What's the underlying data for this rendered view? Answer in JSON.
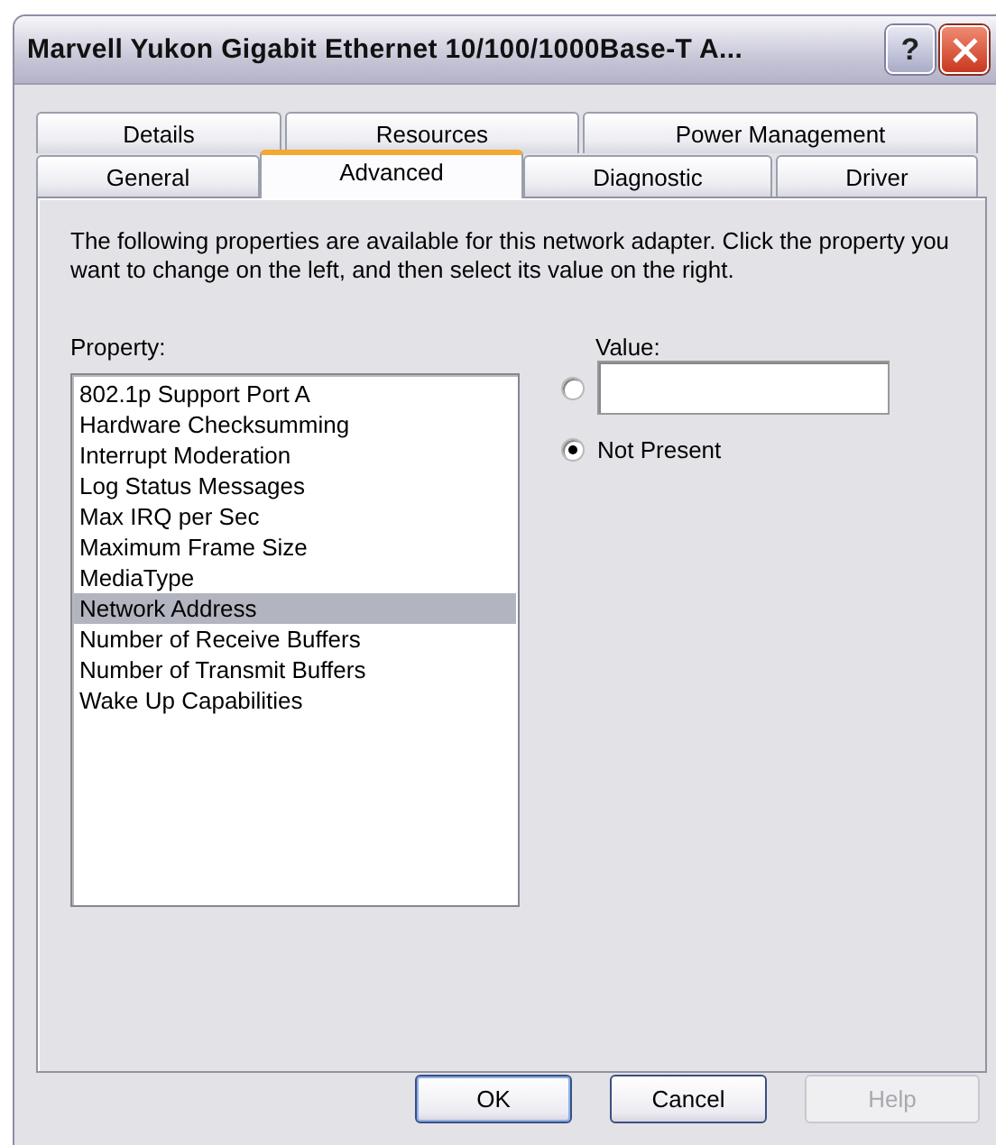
{
  "window": {
    "title": "Marvell Yukon Gigabit Ethernet 10/100/1000Base-T A...",
    "help_button": "?"
  },
  "tab_rows": [
    [
      {
        "label": "Details",
        "selected": false
      },
      {
        "label": "Resources",
        "selected": false
      },
      {
        "label": "Power Management",
        "selected": false
      }
    ],
    [
      {
        "label": "General",
        "selected": false
      },
      {
        "label": "Advanced",
        "selected": true
      },
      {
        "label": "Diagnostic",
        "selected": false
      },
      {
        "label": "Driver",
        "selected": false
      }
    ]
  ],
  "description": "The following properties are available for this network adapter. Click the property you want to change on the left, and then select its value on the right.",
  "property": {
    "label": "Property:",
    "items": [
      {
        "label": "802.1p Support Port A",
        "selected": false
      },
      {
        "label": "Hardware Checksumming",
        "selected": false
      },
      {
        "label": "Interrupt Moderation",
        "selected": false
      },
      {
        "label": "Log Status Messages",
        "selected": false
      },
      {
        "label": "Max IRQ per Sec",
        "selected": false
      },
      {
        "label": "Maximum Frame Size",
        "selected": false
      },
      {
        "label": "MediaType",
        "selected": false
      },
      {
        "label": "Network Address",
        "selected": true
      },
      {
        "label": "Number of Receive Buffers",
        "selected": false
      },
      {
        "label": "Number of Transmit Buffers",
        "selected": false
      },
      {
        "label": "Wake Up Capabilities",
        "selected": false
      }
    ]
  },
  "value": {
    "label": "Value:",
    "options": [
      {
        "kind": "field",
        "selected": false
      },
      {
        "kind": "text",
        "label": "Not Present",
        "selected": true
      }
    ]
  },
  "buttons": [
    {
      "label": "OK",
      "disabled": false,
      "default": true
    },
    {
      "label": "Cancel",
      "disabled": false,
      "default": false
    },
    {
      "label": "Help",
      "disabled": true,
      "default": false
    }
  ]
}
